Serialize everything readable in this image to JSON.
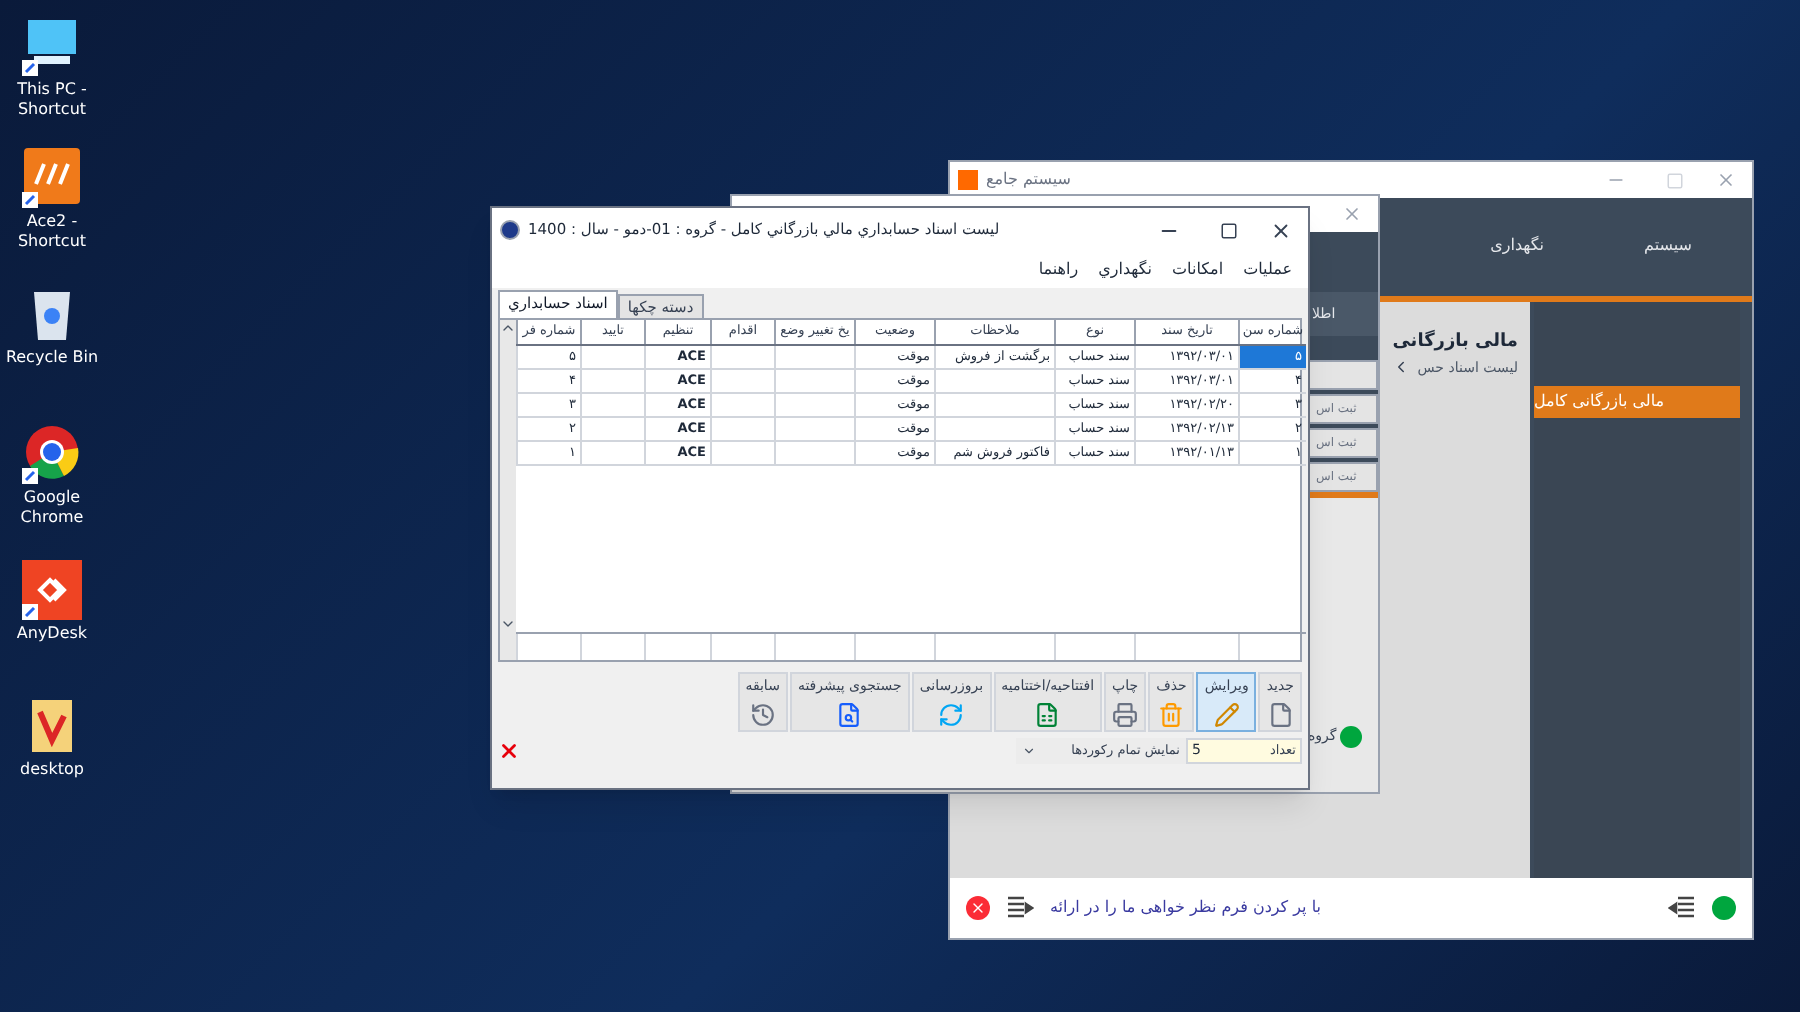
{
  "desktop_icons": [
    {
      "label": "This PC - Shortcut",
      "kind": "pc",
      "shortcut": true
    },
    {
      "label": "Ace2 - Shortcut",
      "kind": "ace",
      "shortcut": true
    },
    {
      "label": "Recycle Bin",
      "kind": "bin",
      "shortcut": false
    },
    {
      "label": "Google Chrome",
      "kind": "chrome",
      "shortcut": true
    },
    {
      "label": "AnyDesk",
      "kind": "anydesk",
      "shortcut": true
    },
    {
      "label": "desktop",
      "kind": "folder",
      "shortcut": false
    }
  ],
  "back_window": {
    "title": "سیستم جامع",
    "menu": [
      "سیستم",
      "نگهداری"
    ],
    "heading": "مالی بازرگانی",
    "breadcrumb": "لیست اسناد حس",
    "side_items": [
      {
        "label": "مالی بازرگانی کامل",
        "selected": true
      }
    ],
    "status_text": "با پر کردن فرم نظر خواهی ما را در ارائه"
  },
  "middle_window": {
    "tab": "اطلا",
    "buttons": [
      "ثبت اس",
      "ثبت اس",
      "ثبت اس"
    ],
    "group_label": "گروه"
  },
  "window": {
    "title": "لیست اسناد حسابداري مالي بازرگاني كامل - گروه : 01-دمو - سال : 1400",
    "menu": [
      "عملیات",
      "امکانات",
      "نگهداري",
      "راهنما"
    ],
    "tabs": [
      {
        "label": "دسته چکها",
        "selected": false
      },
      {
        "label": "اسناد حسابداري",
        "selected": true
      }
    ],
    "table": {
      "columns": [
        "شماره سن",
        "تاریخ سند",
        "نوع",
        "ملاحظات",
        "وضعیت",
        "یخ تغییر وضع",
        "اقدام",
        "تنظیم",
        "تایید",
        "شماره فر"
      ],
      "rows": [
        {
          "cells": [
            "۵",
            "۱۳۹۲/۰۳/۰۱",
            "سند حساب",
            "برگشت از فروش",
            "موقت",
            "",
            "",
            "ACE",
            "",
            "۵"
          ],
          "selected": true
        },
        {
          "cells": [
            "۴",
            "۱۳۹۲/۰۳/۰۱",
            "سند حساب",
            "",
            "موقت",
            "",
            "",
            "ACE",
            "",
            "۴"
          ],
          "selected": false
        },
        {
          "cells": [
            "۳",
            "۱۳۹۲/۰۲/۲۰",
            "سند حساب",
            "",
            "موقت",
            "",
            "",
            "ACE",
            "",
            "۳"
          ],
          "selected": false
        },
        {
          "cells": [
            "۲",
            "۱۳۹۲/۰۲/۱۳",
            "سند حساب",
            "",
            "موقت",
            "",
            "",
            "ACE",
            "",
            "۲"
          ],
          "selected": false
        },
        {
          "cells": [
            "۱",
            "۱۳۹۲/۰۱/۱۳",
            "سند حساب",
            "فاکتور فروش شم",
            "موقت",
            "",
            "",
            "ACE",
            "",
            "۱"
          ],
          "selected": false
        }
      ]
    },
    "toolbar": [
      {
        "label": "جدید",
        "kind": "new",
        "selected": false
      },
      {
        "label": "ویرایش",
        "kind": "edit",
        "selected": true
      },
      {
        "label": "حذف",
        "kind": "delete",
        "selected": false
      },
      {
        "label": "چاپ",
        "kind": "print",
        "selected": false
      },
      {
        "label": "افتتاحیه/اختتامیه",
        "kind": "open_close",
        "selected": false
      },
      {
        "label": "بروزرسانی",
        "kind": "refresh",
        "selected": false
      },
      {
        "label": "جستجوی پیشرفته",
        "kind": "search",
        "selected": false
      },
      {
        "label": "سابقه",
        "kind": "history",
        "selected": false
      }
    ],
    "count_label": "تعداد",
    "count_value": "5",
    "filter": "نمایش تمام رکوردها"
  }
}
